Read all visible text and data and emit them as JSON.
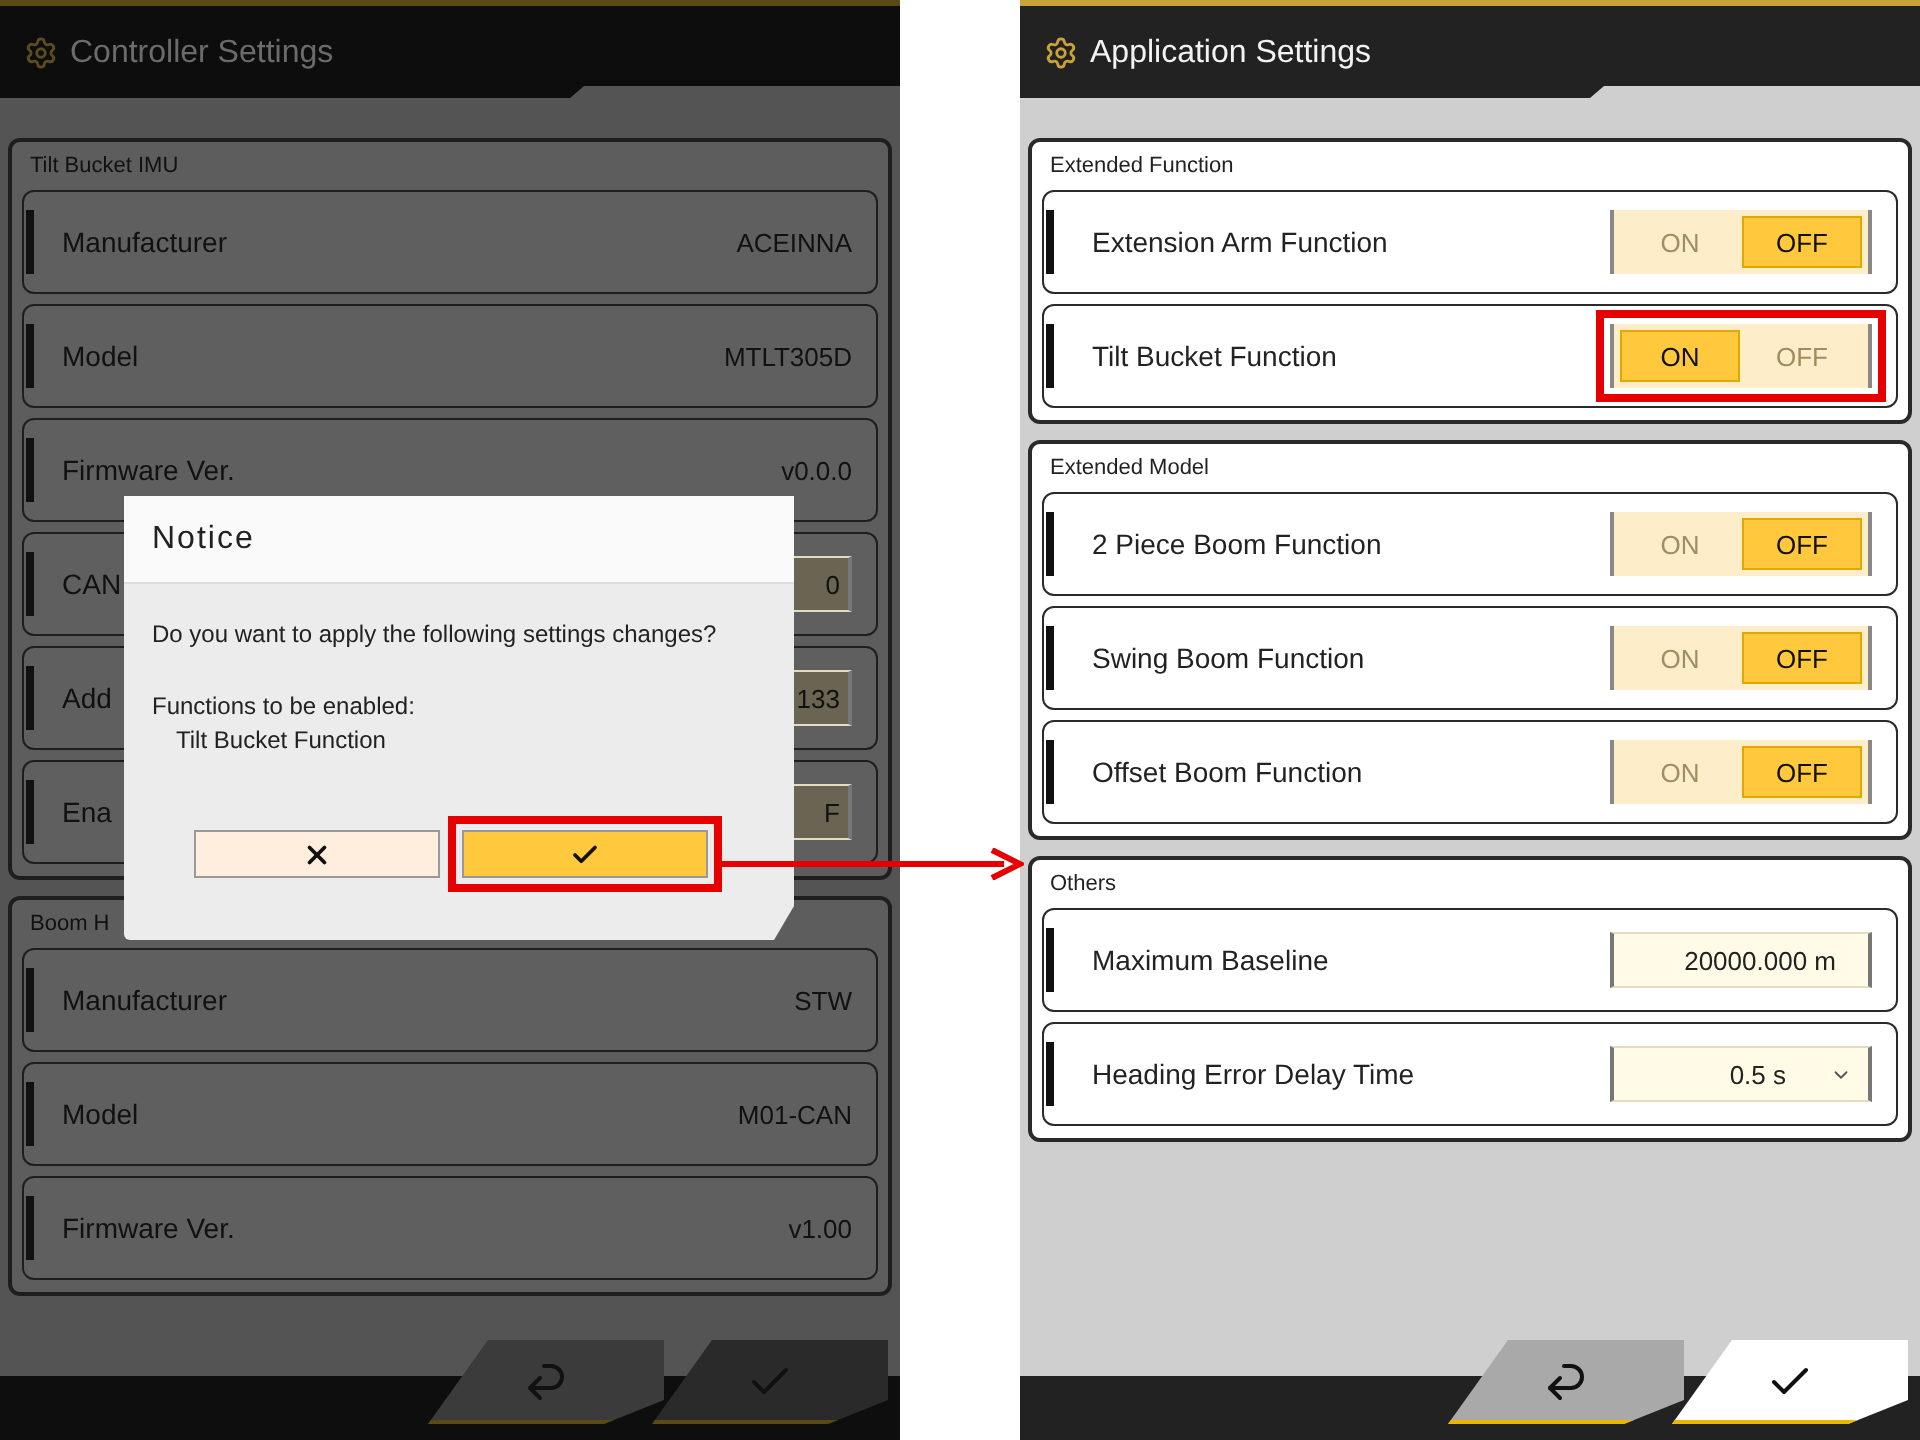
{
  "screens": [
    {
      "title": "Controller Settings",
      "dimmed": true,
      "sections": [
        {
          "label": "Tilt Bucket IMU",
          "rows": [
            {
              "kind": "text",
              "label": "Manufacturer",
              "value": "ACEINNA"
            },
            {
              "kind": "text",
              "label": "Model",
              "value": "MTLT305D"
            },
            {
              "kind": "text",
              "label": "Firmware Ver.",
              "value": "v0.0.0"
            },
            {
              "kind": "partial-field",
              "label": "CAN",
              "value": "0"
            },
            {
              "kind": "partial-field",
              "label": "Add",
              "value": "133"
            },
            {
              "kind": "partial-field",
              "label": "Ena",
              "value": "F"
            }
          ]
        },
        {
          "label": "Boom H",
          "rows": [
            {
              "kind": "text",
              "label": "Manufacturer",
              "value": "STW"
            },
            {
              "kind": "text",
              "label": "Model",
              "value": "M01-CAN"
            },
            {
              "kind": "text",
              "label": "Firmware Ver.",
              "value": "v1.00"
            }
          ]
        }
      ],
      "dialog": {
        "title": "Notice",
        "message": "Do you want to apply the following settings changes?",
        "detail_heading": "Functions to be enabled:",
        "detail_items": [
          "Tilt Bucket Function"
        ],
        "buttons": [
          {
            "kind": "cancel",
            "highlighted": false
          },
          {
            "kind": "confirm",
            "highlighted": true
          }
        ]
      }
    },
    {
      "title": "Application Settings",
      "dimmed": false,
      "sections": [
        {
          "label": "Extended Function",
          "rows": [
            {
              "kind": "toggle",
              "label": "Extension Arm Function",
              "on_label": "ON",
              "off_label": "OFF",
              "on": false,
              "highlighted": false
            },
            {
              "kind": "toggle",
              "label": "Tilt Bucket Function",
              "on_label": "ON",
              "off_label": "OFF",
              "on": true,
              "highlighted": true
            }
          ]
        },
        {
          "label": "Extended Model",
          "rows": [
            {
              "kind": "toggle",
              "label": "2 Piece Boom Function",
              "on_label": "ON",
              "off_label": "OFF",
              "on": false,
              "highlighted": false
            },
            {
              "kind": "toggle",
              "label": "Swing Boom Function",
              "on_label": "ON",
              "off_label": "OFF",
              "on": false,
              "highlighted": false
            },
            {
              "kind": "toggle",
              "label": "Offset Boom Function",
              "on_label": "ON",
              "off_label": "OFF",
              "on": false,
              "highlighted": false
            }
          ]
        },
        {
          "label": "Others",
          "rows": [
            {
              "kind": "field",
              "label": "Maximum Baseline",
              "value": "20000.000 m"
            },
            {
              "kind": "select",
              "label": "Heading Error Delay Time",
              "value": "0.5 s"
            }
          ]
        }
      ]
    }
  ],
  "connector_arrow": true
}
